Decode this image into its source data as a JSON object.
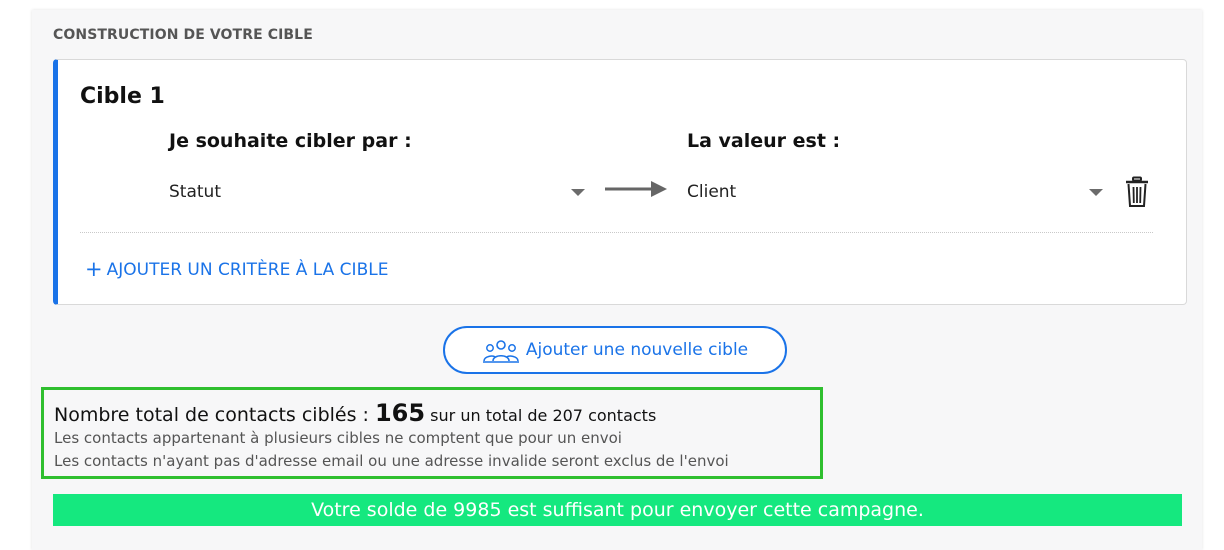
{
  "section_title": "CONSTRUCTION DE VOTRE CIBLE",
  "target": {
    "title": "Cible 1",
    "criterion_label": "Je souhaite cibler par :",
    "value_label": "La valeur est :",
    "criterion_value": "Statut",
    "value_value": "Client",
    "add_criterion_plus": "+",
    "add_criterion_label": "AJOUTER UN CRITÈRE À LA CIBLE"
  },
  "add_target_button": "Ajouter une nouvelle cible",
  "stats": {
    "total_label": "Nombre total de contacts ciblés : ",
    "total_count": "165",
    "total_suffix": " sur un total de 207 contacts",
    "note_multiple": "Les contacts appartenant à plusieurs cibles ne comptent que pour un envoi",
    "note_invalid": "Les contacts n'ayant pas d'adresse email ou une adresse invalide seront exclus de l'envoi"
  },
  "balance_message": "Votre solde de 9985 est suffisant pour envoyer cette campagne.",
  "colors": {
    "accent": "#1a73e8",
    "highlight_border": "#2fbf2f",
    "success_banner": "#15e87f"
  },
  "icons": {
    "arrow": "arrow-right-icon",
    "trash": "trash-icon",
    "caret": "caret-down-icon",
    "people": "people-group-icon"
  }
}
